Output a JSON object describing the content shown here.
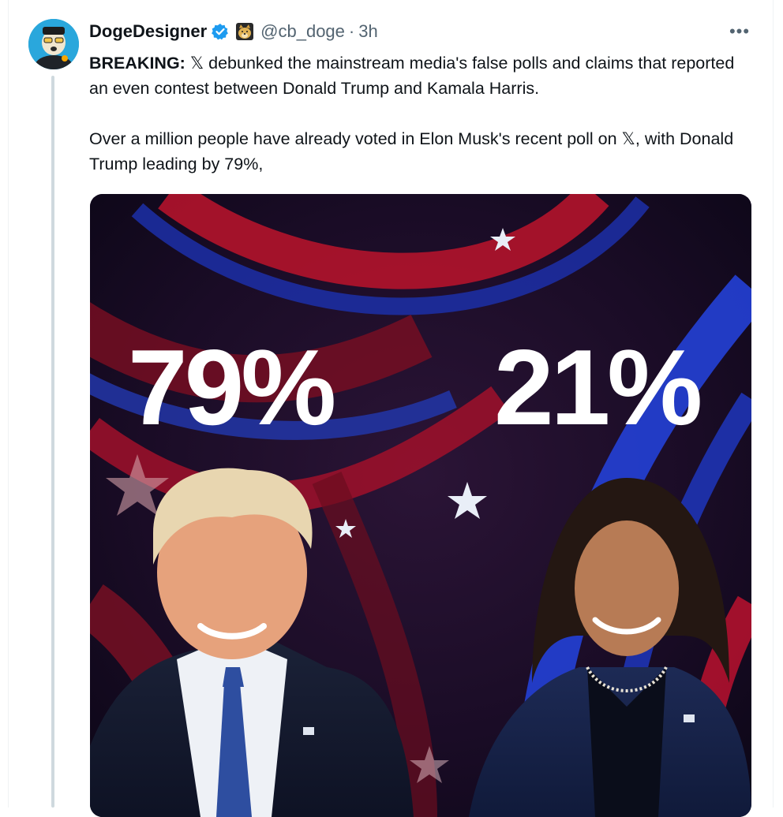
{
  "tweet": {
    "author": {
      "display_name": "DogeDesigner",
      "handle": "@cb_doge",
      "verified_icon": "verified-badge-icon",
      "affiliate_icon": "doge-emoji-icon"
    },
    "separator": "·",
    "timestamp": "3h",
    "more_label": "•••",
    "text": {
      "lead": "BREAKING:",
      "paragraph1": " 𝕏 debunked the mainstream media's false polls and claims that reported an even contest between Donald Trump and Kamala Harris.",
      "paragraph2": "Over a million people have already voted in Elon Musk's recent poll on 𝕏, with Donald Trump leading by 79%,"
    },
    "media": {
      "left_percent": "79%",
      "right_percent": "21%"
    }
  },
  "colors": {
    "text": "#0f1419",
    "secondary": "#536471",
    "verified_blue": "#1d9bf0",
    "thread_line": "#cfd9de"
  }
}
